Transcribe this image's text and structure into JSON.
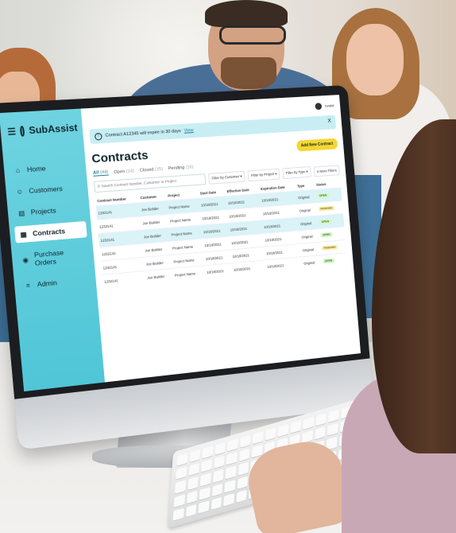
{
  "app": {
    "brand": "SubAssist",
    "user_name": "Avatar"
  },
  "sidebar": {
    "items": [
      {
        "label": "Home",
        "icon": "home-icon"
      },
      {
        "label": "Customers",
        "icon": "user-icon"
      },
      {
        "label": "Projects",
        "icon": "clipboard-icon"
      },
      {
        "label": "Contracts",
        "icon": "document-icon",
        "active": true
      },
      {
        "label": "Purchase Orders",
        "icon": "dollar-icon"
      },
      {
        "label": "Admin",
        "icon": "sliders-icon"
      }
    ]
  },
  "banner": {
    "text": "Contract A12345 will expire in 30 days",
    "link": "View",
    "close": "X"
  },
  "page": {
    "title": "Contracts",
    "add_button": "Add New Contract"
  },
  "tabs": [
    {
      "label": "All",
      "count": "(44)"
    },
    {
      "label": "Open",
      "count": "(14)"
    },
    {
      "label": "Closed",
      "count": "(15)"
    },
    {
      "label": "Pending",
      "count": "(16)"
    }
  ],
  "filters": {
    "search_placeholder": "Search Contract Number, Customer or Project",
    "customer": "Filter by Customer",
    "project": "Filter by Project",
    "type": "Filter by Type",
    "more": "More Filters"
  },
  "table": {
    "headers": [
      "Contract Number",
      "Customer",
      "Project",
      "Start Date",
      "Effective Date",
      "Expiration Date",
      "Type",
      "Status"
    ],
    "rows": [
      [
        "1232141",
        "Joe Builder",
        "Project Name",
        "10/18/2021",
        "10/18/2021",
        "10/18/2021",
        "Original",
        "OPEN"
      ],
      [
        "1232141",
        "Joe Builder",
        "Project Name",
        "10/18/2021",
        "10/18/2021",
        "10/18/2021",
        "Original",
        "PENDING"
      ],
      [
        "1232141",
        "Joe Builder",
        "Project Name",
        "10/18/2021",
        "10/18/2021",
        "10/18/2021",
        "Original",
        "OPEN"
      ],
      [
        "1232141",
        "Joe Builder",
        "Project Name",
        "10/18/2021",
        "10/18/2021",
        "10/18/2021",
        "Original",
        "OPEN"
      ],
      [
        "1232141",
        "Joe Builder",
        "Project Name",
        "10/18/2021",
        "10/18/2021",
        "10/18/2021",
        "Original",
        "PENDING"
      ],
      [
        "1232141",
        "Joe Builder",
        "Project Name",
        "10/18/2021",
        "10/18/2021",
        "10/18/2021",
        "Original",
        "OPEN"
      ]
    ]
  },
  "colors": {
    "sidebar": "#4fc6d7",
    "accent": "#1a7fa0",
    "button": "#f5d733"
  }
}
